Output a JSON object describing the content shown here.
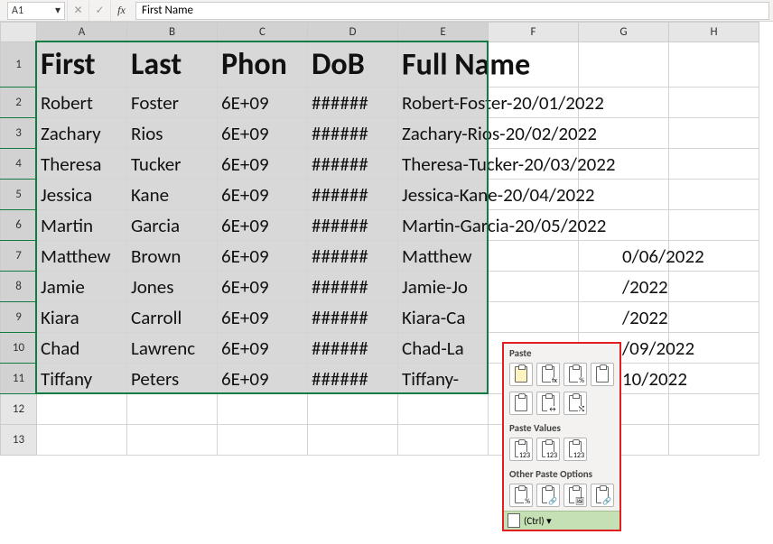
{
  "nameBox": "A1",
  "formulaValue": "First Name",
  "columns": [
    "A",
    "B",
    "C",
    "D",
    "E",
    "F",
    "G",
    "H"
  ],
  "colWidths": {
    "A": 100,
    "B": 100,
    "C": 100,
    "D": 100,
    "E": 100,
    "F": 100,
    "G": 100,
    "H": 100
  },
  "selection": "A1:E11",
  "headerRow": {
    "A": "First",
    "B": "Last",
    "C": "Phon",
    "D": "DoB",
    "E": "Full Name"
  },
  "rows": [
    {
      "n": 1
    },
    {
      "n": 2,
      "A": "Robert",
      "B": "Foster",
      "C": "6E+09",
      "D": "######",
      "E": "Robert-Foster-20/01/2022"
    },
    {
      "n": 3,
      "A": "Zachary",
      "B": "Rios",
      "C": "6E+09",
      "D": "######",
      "E": "Zachary-Rios-20/02/2022"
    },
    {
      "n": 4,
      "A": "Theresa",
      "B": "Tucker",
      "C": "6E+09",
      "D": "######",
      "E": "Theresa-Tucker-20/03/2022"
    },
    {
      "n": 5,
      "A": "Jessica",
      "B": "Kane",
      "C": "6E+09",
      "D": "######",
      "E": "Jessica-Kane-20/04/2022"
    },
    {
      "n": 6,
      "A": "Martin",
      "B": "Garcia",
      "C": "6E+09",
      "D": "######",
      "E": "Martin-Garcia-20/05/2022"
    },
    {
      "n": 7,
      "A": "Matthew",
      "B": "Brown",
      "C": "6E+09",
      "D": "######",
      "E": "Matthew",
      "Etrail": "0/06/2022"
    },
    {
      "n": 8,
      "A": "Jamie",
      "B": "Jones",
      "C": "6E+09",
      "D": "######",
      "E": "Jamie-Jo",
      "Etrail": "/2022"
    },
    {
      "n": 9,
      "A": "Kiara",
      "B": "Carroll",
      "C": "6E+09",
      "D": "######",
      "E": "Kiara-Ca",
      "Etrail": "/2022"
    },
    {
      "n": 10,
      "A": "Chad",
      "B": "Lawrenc",
      "C": "6E+09",
      "D": "######",
      "E": "Chad-La",
      "Etrail": "/09/2022"
    },
    {
      "n": 11,
      "A": "Tiffany",
      "B": "Peters",
      "C": "6E+09",
      "D": "######",
      "E": "Tiffany-",
      "Etrail": "10/2022"
    },
    {
      "n": 12
    },
    {
      "n": 13
    }
  ],
  "pastePopup": {
    "sections": [
      {
        "title": "Paste",
        "icons": [
          [
            "paste",
            "paste-formulas",
            "paste-formulas-formatting",
            "paste-keep-source"
          ],
          [
            "paste-no-borders",
            "paste-keep-widths",
            "paste-transpose"
          ]
        ]
      },
      {
        "title": "Paste Values",
        "icons": [
          [
            "values",
            "values-number-fmt",
            "values-source-fmt"
          ]
        ]
      },
      {
        "title": "Other Paste Options",
        "icons": [
          [
            "paste-formatting",
            "paste-link",
            "paste-picture",
            "paste-linked-picture"
          ]
        ]
      }
    ],
    "footer": "(Ctrl) ▾"
  }
}
